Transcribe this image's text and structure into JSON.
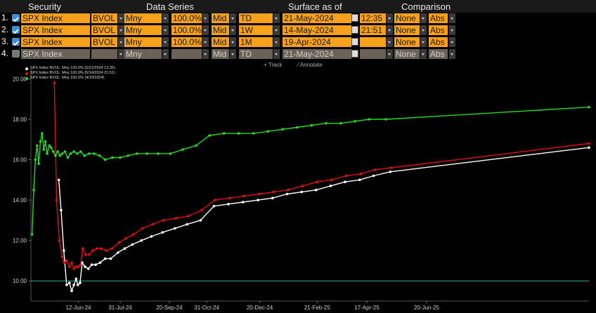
{
  "header": {
    "security": "Security",
    "data_series": "Data Series",
    "surface_as_of": "Surface as of",
    "comparison": "Comparison"
  },
  "rows": [
    {
      "num": "1.",
      "checked": true,
      "security": "SPX Index",
      "field": "BVOL",
      "moneyness": "Mny",
      "level": "100.0%",
      "side": "Mid",
      "tenor": "TD",
      "date": "21-May-2024",
      "time": "12:35",
      "comparison": "None",
      "abs": "Abs"
    },
    {
      "num": "2.",
      "checked": true,
      "security": "SPX Index",
      "field": "BVOL",
      "moneyness": "Mny",
      "level": "100.0%",
      "side": "Mid",
      "tenor": "1W",
      "date": "14-May-2024",
      "time": "21:51",
      "comparison": "None",
      "abs": "Abs"
    },
    {
      "num": "3.",
      "checked": true,
      "security": "SPX Index",
      "field": "BVOL",
      "moneyness": "Mny",
      "level": "100.0%",
      "side": "Mid",
      "tenor": "1M",
      "date": "19-Apr-2024",
      "time": "",
      "comparison": "None",
      "abs": "Abs"
    },
    {
      "num": "4.",
      "checked": false,
      "security": "SPX Index",
      "field": "",
      "moneyness": "Mny",
      "level": "",
      "side": "Mid",
      "tenor": "TD",
      "date": "21-May-2024",
      "time": "",
      "comparison": "None",
      "abs": "Abs"
    }
  ],
  "toolbar": {
    "track": "Track",
    "annotate": "Annotate"
  },
  "colors": {
    "accent": "#f7a11a",
    "white_series": "#ffffff",
    "red_series": "#e01010",
    "green_series": "#22dd22",
    "ref_line": "#33aaaa"
  },
  "chart_data": {
    "type": "line",
    "legend": [
      {
        "label": "SPX Index BVOL: Mny 100.0% (5/21/2024 12:35)",
        "color": "#ffffff"
      },
      {
        "label": "SPX Index BVOL: Mny 100.0% (5/14/2024 21:51)",
        "color": "#e01010"
      },
      {
        "label": "SPX Index BVOL: Mny 100.0% (4/19/2024)",
        "color": "#22dd22"
      }
    ],
    "ylim": [
      9.0,
      20.5
    ],
    "y_ticks": [
      "10.00",
      "12.00",
      "14.00",
      "16.00",
      "18.00",
      "20.00"
    ],
    "y_tick_values": [
      10,
      12,
      14,
      16,
      18,
      20
    ],
    "xlim": [
      0,
      100
    ],
    "x_ticks": [
      {
        "label": "12-Jun-24",
        "x": 8.5
      },
      {
        "label": "31-Jul-24",
        "x": 16.0
      },
      {
        "label": "20-Sep-24",
        "x": 24.8
      },
      {
        "label": "31-Oct-24",
        "x": 31.5
      },
      {
        "label": "20-Dec-24",
        "x": 41.0
      },
      {
        "label": "21-Feb-25",
        "x": 51.3
      },
      {
        "label": "17-Apr-25",
        "x": 60.2
      },
      {
        "label": "20-Jun-25",
        "x": 70.9
      }
    ],
    "reference_line": 10.0,
    "series": [
      {
        "name": "white",
        "color": "#ffffff",
        "points": [
          [
            5.0,
            15.0
          ],
          [
            5.4,
            13.5
          ],
          [
            5.9,
            11.5
          ],
          [
            6.4,
            9.8
          ],
          [
            6.9,
            9.9
          ],
          [
            7.3,
            9.5
          ],
          [
            7.7,
            9.8
          ],
          [
            8.1,
            10.1
          ],
          [
            8.4,
            9.8
          ],
          [
            8.8,
            9.9
          ],
          [
            9.2,
            10.9
          ],
          [
            9.7,
            10.7
          ],
          [
            10.3,
            10.6
          ],
          [
            10.9,
            10.8
          ],
          [
            11.6,
            10.8
          ],
          [
            12.4,
            10.9
          ],
          [
            13.3,
            11.1
          ],
          [
            14.3,
            11.1
          ],
          [
            15.6,
            11.4
          ],
          [
            16.8,
            11.6
          ],
          [
            18.2,
            11.8
          ],
          [
            19.8,
            12.0
          ],
          [
            21.6,
            12.2
          ],
          [
            23.6,
            12.4
          ],
          [
            25.8,
            12.6
          ],
          [
            28.0,
            12.8
          ],
          [
            30.4,
            13.0
          ],
          [
            32.8,
            13.7
          ],
          [
            35.4,
            13.8
          ],
          [
            38.0,
            13.9
          ],
          [
            40.7,
            14.0
          ],
          [
            43.3,
            14.1
          ],
          [
            45.9,
            14.3
          ],
          [
            48.5,
            14.4
          ],
          [
            51.1,
            14.5
          ],
          [
            53.7,
            14.7
          ],
          [
            56.3,
            14.9
          ],
          [
            58.9,
            15.0
          ],
          [
            61.4,
            15.2
          ],
          [
            64.4,
            15.4
          ],
          [
            100.0,
            16.6
          ]
        ]
      },
      {
        "name": "red",
        "color": "#e01010",
        "points": [
          [
            4.2,
            19.8
          ],
          [
            4.6,
            14.0
          ],
          [
            5.1,
            12.0
          ],
          [
            5.6,
            11.2
          ],
          [
            6.0,
            10.9
          ],
          [
            6.4,
            11.0
          ],
          [
            6.9,
            10.7
          ],
          [
            7.3,
            10.9
          ],
          [
            7.7,
            10.6
          ],
          [
            8.1,
            10.7
          ],
          [
            8.5,
            10.7
          ],
          [
            8.9,
            10.8
          ],
          [
            9.3,
            11.6
          ],
          [
            9.8,
            11.3
          ],
          [
            10.4,
            11.3
          ],
          [
            11.1,
            11.5
          ],
          [
            11.8,
            11.6
          ],
          [
            12.6,
            11.6
          ],
          [
            13.5,
            11.5
          ],
          [
            14.5,
            11.6
          ],
          [
            15.8,
            11.9
          ],
          [
            17.0,
            12.1
          ],
          [
            18.4,
            12.3
          ],
          [
            20.0,
            12.6
          ],
          [
            21.8,
            12.8
          ],
          [
            23.8,
            13.0
          ],
          [
            26.0,
            13.1
          ],
          [
            28.2,
            13.2
          ],
          [
            30.6,
            13.5
          ],
          [
            33.0,
            14.0
          ],
          [
            35.6,
            14.1
          ],
          [
            38.2,
            14.2
          ],
          [
            40.9,
            14.3
          ],
          [
            43.5,
            14.4
          ],
          [
            46.1,
            14.5
          ],
          [
            48.7,
            14.7
          ],
          [
            51.3,
            14.9
          ],
          [
            53.9,
            15.0
          ],
          [
            56.5,
            15.2
          ],
          [
            59.1,
            15.3
          ],
          [
            61.6,
            15.5
          ],
          [
            64.6,
            15.6
          ],
          [
            100.0,
            16.8
          ]
        ]
      },
      {
        "name": "green",
        "color": "#22dd22",
        "points": [
          [
            0.2,
            12.3
          ],
          [
            0.5,
            14.5
          ],
          [
            0.8,
            16.0
          ],
          [
            1.1,
            16.7
          ],
          [
            1.4,
            15.8
          ],
          [
            1.7,
            16.9
          ],
          [
            2.0,
            17.3
          ],
          [
            2.3,
            16.5
          ],
          [
            2.6,
            16.9
          ],
          [
            2.9,
            16.3
          ],
          [
            3.3,
            16.7
          ],
          [
            3.6,
            16.6
          ],
          [
            4.0,
            16.4
          ],
          [
            4.4,
            16.2
          ],
          [
            4.8,
            16.4
          ],
          [
            5.2,
            16.2
          ],
          [
            5.6,
            16.3
          ],
          [
            6.1,
            16.4
          ],
          [
            6.6,
            16.1
          ],
          [
            7.1,
            16.3
          ],
          [
            7.7,
            16.4
          ],
          [
            8.3,
            16.3
          ],
          [
            8.9,
            16.4
          ],
          [
            9.6,
            16.2
          ],
          [
            10.4,
            16.3
          ],
          [
            11.3,
            16.3
          ],
          [
            12.3,
            16.2
          ],
          [
            13.3,
            16.0
          ],
          [
            14.6,
            16.1
          ],
          [
            16.0,
            16.1
          ],
          [
            17.4,
            16.2
          ],
          [
            19.0,
            16.3
          ],
          [
            20.8,
            16.3
          ],
          [
            22.8,
            16.3
          ],
          [
            25.0,
            16.3
          ],
          [
            27.2,
            16.5
          ],
          [
            29.6,
            16.7
          ],
          [
            32.0,
            17.2
          ],
          [
            34.6,
            17.3
          ],
          [
            37.2,
            17.3
          ],
          [
            39.9,
            17.3
          ],
          [
            42.5,
            17.4
          ],
          [
            45.1,
            17.5
          ],
          [
            47.7,
            17.6
          ],
          [
            50.3,
            17.7
          ],
          [
            52.9,
            17.8
          ],
          [
            55.5,
            17.8
          ],
          [
            58.1,
            17.9
          ],
          [
            60.6,
            18.0
          ],
          [
            63.6,
            18.0
          ],
          [
            100.0,
            18.6
          ]
        ]
      }
    ]
  }
}
